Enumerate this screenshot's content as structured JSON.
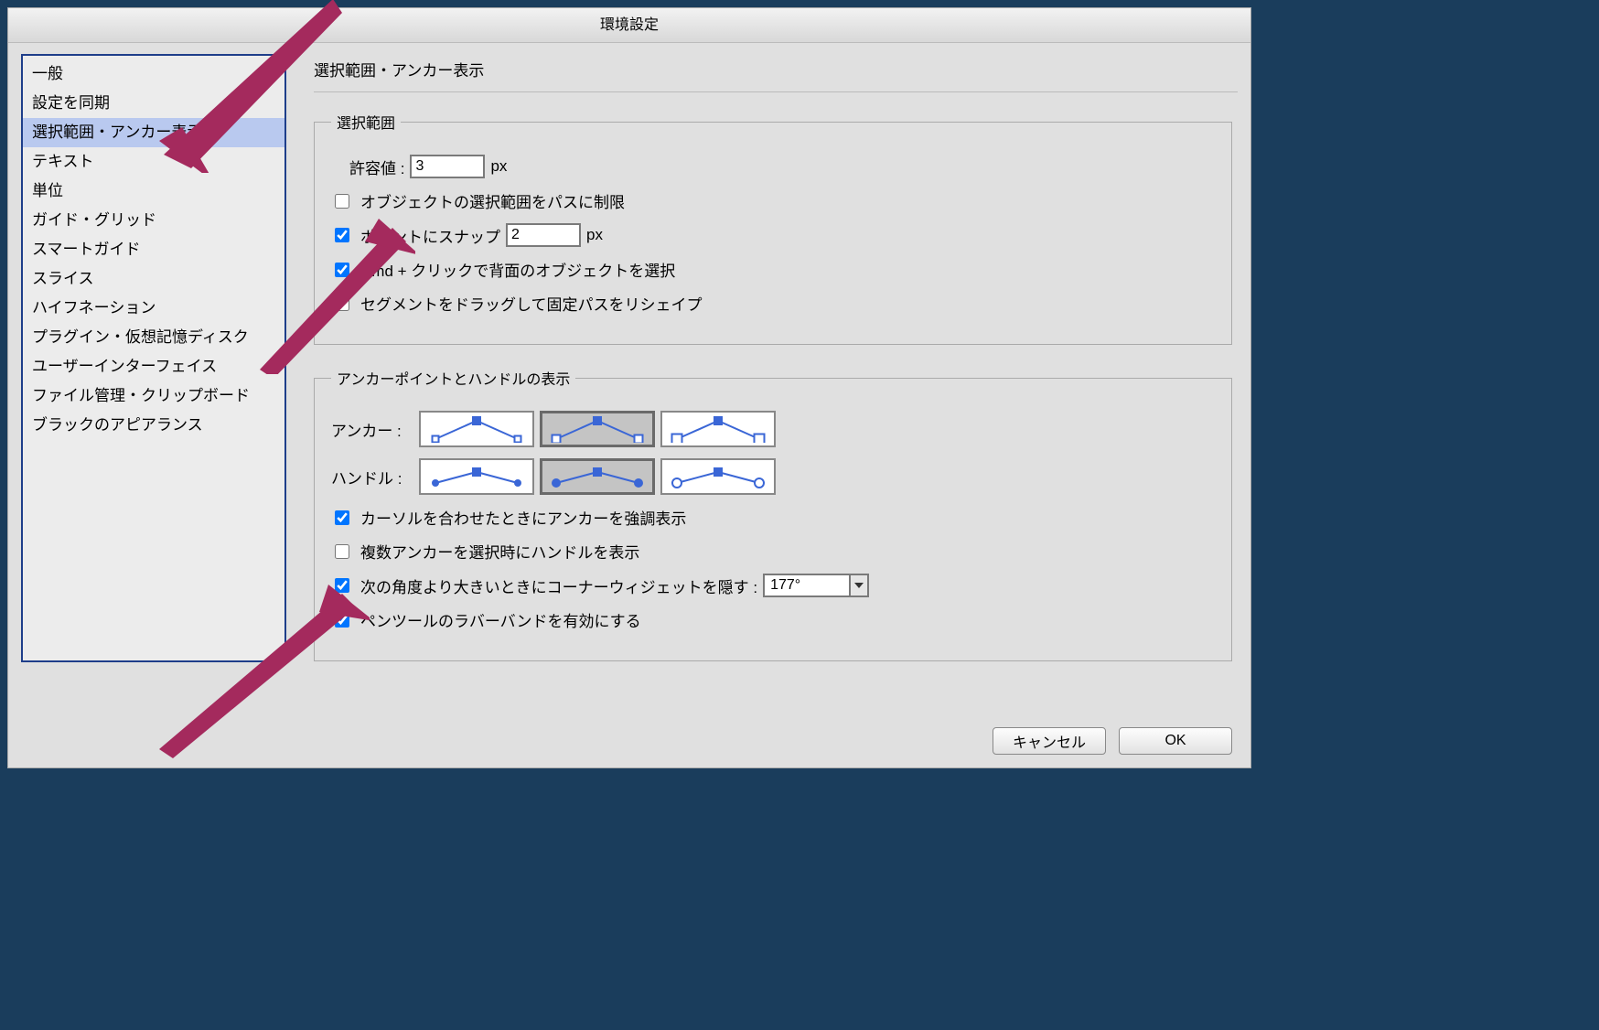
{
  "title": "環境設定",
  "sidebar": {
    "items": [
      {
        "label": "一般"
      },
      {
        "label": "設定を同期"
      },
      {
        "label": "選択範囲・アンカー表示",
        "selected": true
      },
      {
        "label": "テキスト"
      },
      {
        "label": "単位"
      },
      {
        "label": "ガイド・グリッド"
      },
      {
        "label": "スマートガイド"
      },
      {
        "label": "スライス"
      },
      {
        "label": "ハイフネーション"
      },
      {
        "label": "プラグイン・仮想記憶ディスク"
      },
      {
        "label": "ユーザーインターフェイス"
      },
      {
        "label": "ファイル管理・クリップボード"
      },
      {
        "label": "ブラックのアピアランス"
      }
    ]
  },
  "main": {
    "heading": "選択範囲・アンカー表示",
    "selection": {
      "legend": "選択範囲",
      "tolerance_label": "許容値 :",
      "tolerance_value": "3",
      "tolerance_unit": "px",
      "restrict_label": "オブジェクトの選択範囲をパスに制限",
      "restrict_checked": false,
      "snap_label": "ポイントにスナップ",
      "snap_checked": true,
      "snap_value": "2",
      "snap_unit": "px",
      "cmdclick_label": "Cmd + クリックで背面のオブジェクトを選択",
      "cmdclick_checked": true,
      "reshape_label": "セグメントをドラッグして固定パスをリシェイプ",
      "reshape_checked": false
    },
    "anchors": {
      "legend": "アンカーポイントとハンドルの表示",
      "anchor_label": "アンカー :",
      "anchor_selected": 1,
      "handle_label": "ハンドル :",
      "handle_selected": 1,
      "highlight_label": "カーソルを合わせたときにアンカーを強調表示",
      "highlight_checked": true,
      "multi_label": "複数アンカーを選択時にハンドルを表示",
      "multi_checked": false,
      "corner_label": "次の角度より大きいときにコーナーウィジェットを隠す :",
      "corner_checked": true,
      "corner_value": "177°",
      "rubber_label": "ペンツールのラバーバンドを有効にする",
      "rubber_checked": true
    }
  },
  "footer": {
    "cancel": "キャンセル",
    "ok": "OK"
  }
}
